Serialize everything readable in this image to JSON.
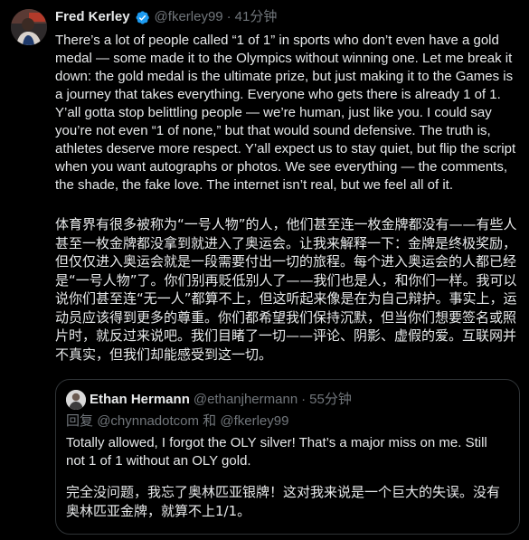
{
  "tweet": {
    "author_name": "Fred Kerley",
    "handle": "@fkerley99",
    "separator": "·",
    "time": "41分钟",
    "body_en": "There’s a lot of people called “1 of 1” in sports who don’t even have a gold medal — some made it to the Olympics without winning one. Let me break it down: the gold medal is the ultimate prize, but just making it to the Games is a journey that takes everything. Everyone who gets there is already 1 of 1. Y’all gotta stop belittling people — we’re human, just like you. I could say you’re not even “1 of none,” but that would sound defensive. The truth is, athletes deserve more respect. Y’all expect us to stay quiet, but flip the script when you want autographs or photos. We see everything — the comments, the shade, the fake love. The internet isn’t real, but we feel all of it.",
    "body_zh": "体育界有很多被称为“一号人物”的人，他们甚至连一枚金牌都没有——有些人甚至一枚金牌都没拿到就进入了奥运会。让我来解释一下：金牌是终极奖励，但仅仅进入奥运会就是一段需要付出一切的旅程。每个进入奥运会的人都已经是“一号人物”了。你们别再贬低别人了——我们也是人，和你们一样。我可以说你们甚至连“无一人”都算不上，但这听起来像是在为自己辩护。事实上，运动员应该得到更多的尊重。你们都希望我们保持沉默，但当你们想要签名或照片时，就反过来说吧。我们目睹了一切——评论、阴影、虚假的爱。互联网并不真实，但我们却能感受到这一切。"
  },
  "quote": {
    "author_name": "Ethan Hermann",
    "handle": "@ethanjhermann",
    "separator": "·",
    "time": "55分钟",
    "reply_prefix": "回复",
    "reply_to_1": "@chynnadotcom",
    "reply_joiner": "和",
    "reply_to_2": "@fkerley99",
    "body_en": "Totally allowed, I forgot the OLY silver! That’s a major miss on me. Still not 1 of 1 without an OLY gold.",
    "body_zh": "完全没问题，我忘了奥林匹亚银牌！这对我来说是一个巨大的失误。没有奥林匹亚金牌，就算不上1/1。"
  },
  "colors": {
    "background": "#000000",
    "text_primary": "#e7e9ea",
    "text_muted": "#71767b",
    "border": "#2f3336",
    "verified_badge": "#1d9bf0"
  },
  "icons": {
    "verified": "verified-badge-icon"
  }
}
